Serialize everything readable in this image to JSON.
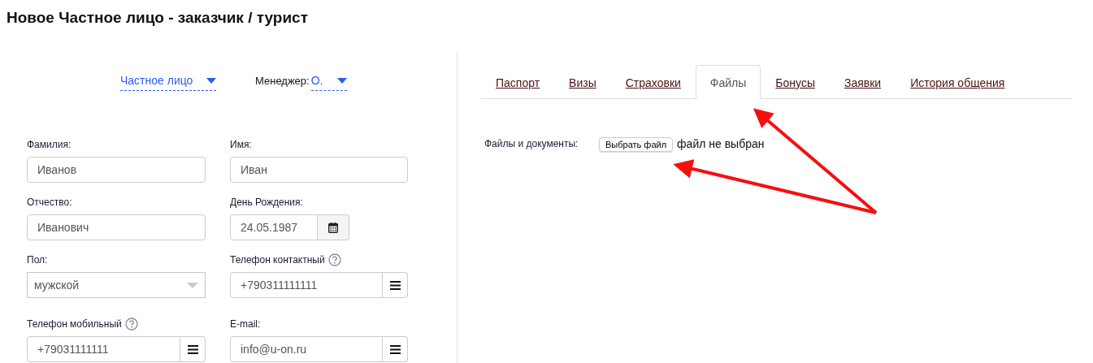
{
  "page_title": "Новое Частное лицо - заказчик / турист",
  "type_select": {
    "value": "Частное лицо"
  },
  "manager": {
    "label": "Менеджер:",
    "value": "О."
  },
  "fields": [
    {
      "label": "Фамилия:",
      "value": "Иванов",
      "kind": "text",
      "help": false
    },
    {
      "label": "Имя:",
      "value": "Иван",
      "kind": "text",
      "help": false
    },
    {
      "label": "Отчество:",
      "value": "Иванович",
      "kind": "text",
      "help": false
    },
    {
      "label": "День Рождения:",
      "value": "24.05.1987",
      "kind": "date",
      "help": false
    },
    {
      "label": "Пол:",
      "value": "мужской",
      "kind": "select",
      "help": false
    },
    {
      "label": "Телефон контактный",
      "value": "+790311111111",
      "kind": "menu",
      "help": true
    },
    {
      "label": "Телефон мобильный",
      "value": "+79031111111",
      "kind": "menu",
      "help": true
    },
    {
      "label": "E-mail:",
      "value": "info@u-on.ru",
      "kind": "menu",
      "help": false
    }
  ],
  "tabs": [
    {
      "label": "Паспорт",
      "selected": false
    },
    {
      "label": "Визы",
      "selected": false
    },
    {
      "label": "Страховки",
      "selected": false
    },
    {
      "label": "Файлы",
      "selected": true
    },
    {
      "label": "Бонусы",
      "selected": false
    },
    {
      "label": "Заявки",
      "selected": false
    },
    {
      "label": "История общения",
      "selected": false
    }
  ],
  "files": {
    "label": "Файлы и документы:",
    "button": "Выбрать файл",
    "status": "файл не выбран"
  }
}
